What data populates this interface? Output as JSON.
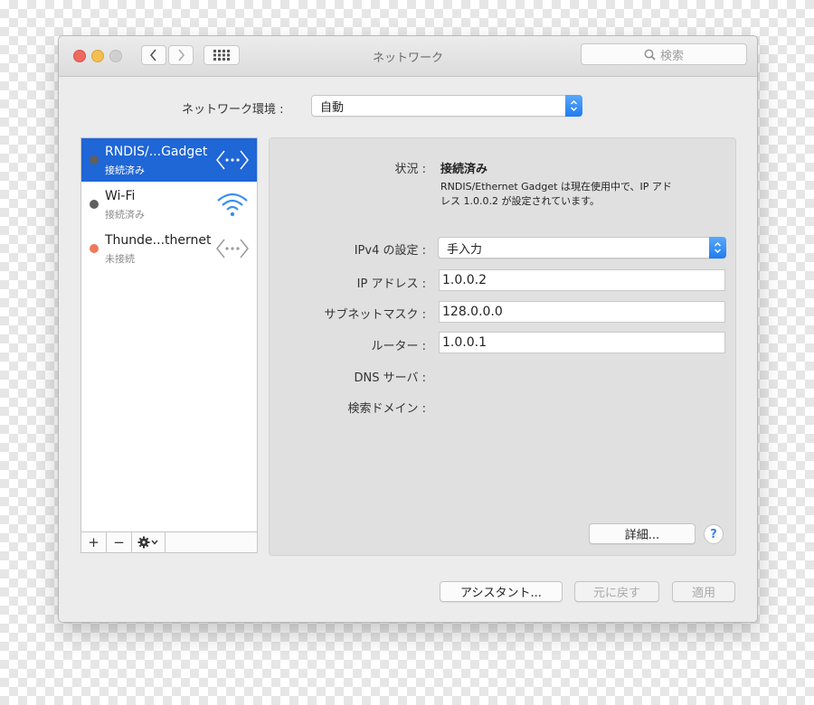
{
  "window": {
    "title": "ネットワーク",
    "search_placeholder": "検索"
  },
  "location": {
    "label": "ネットワーク環境 :",
    "value": "自動"
  },
  "services": [
    {
      "name": "RNDIS/...Gadget",
      "status": "接続済み",
      "dot_color": "#5f5f5f",
      "icon": "ethernet-icon",
      "selected": true
    },
    {
      "name": "Wi-Fi",
      "status": "接続済み",
      "dot_color": "#5f5f5f",
      "icon": "wifi-icon",
      "selected": false
    },
    {
      "name": "Thunde...thernet",
      "status": "未接続",
      "dot_color": "#ee7a5a",
      "icon": "ethernet-icon",
      "selected": false
    }
  ],
  "sidebar_actions": {
    "add": "+",
    "remove": "−",
    "gear": "gear-icon"
  },
  "detail": {
    "status_label": "状況 :",
    "status_value": "接続済み",
    "status_desc": [
      "RNDIS/Ethernet Gadget は現在使用中で、IP アド",
      "レス 1.0.0.2 が設定されています。"
    ],
    "ipv4_label": "IPv4 の設定 :",
    "ipv4_value": "手入力",
    "ip_label": "IP アドレス :",
    "ip_value": "1.0.0.2",
    "subnet_label": "サブネットマスク :",
    "subnet_value": "128.0.0.0",
    "router_label": "ルーター :",
    "router_value": "1.0.0.1",
    "dns_label": "DNS サーバ :",
    "search_domain_label": "検索ドメイン :",
    "advanced_label": "詳細...",
    "help_label": "?"
  },
  "footer": {
    "assistant_label": "アシスタント...",
    "revert_label": "元に戻す",
    "apply_label": "適用"
  },
  "colors": {
    "selection": "#1f66d6",
    "accent": "#1f7cf2"
  }
}
